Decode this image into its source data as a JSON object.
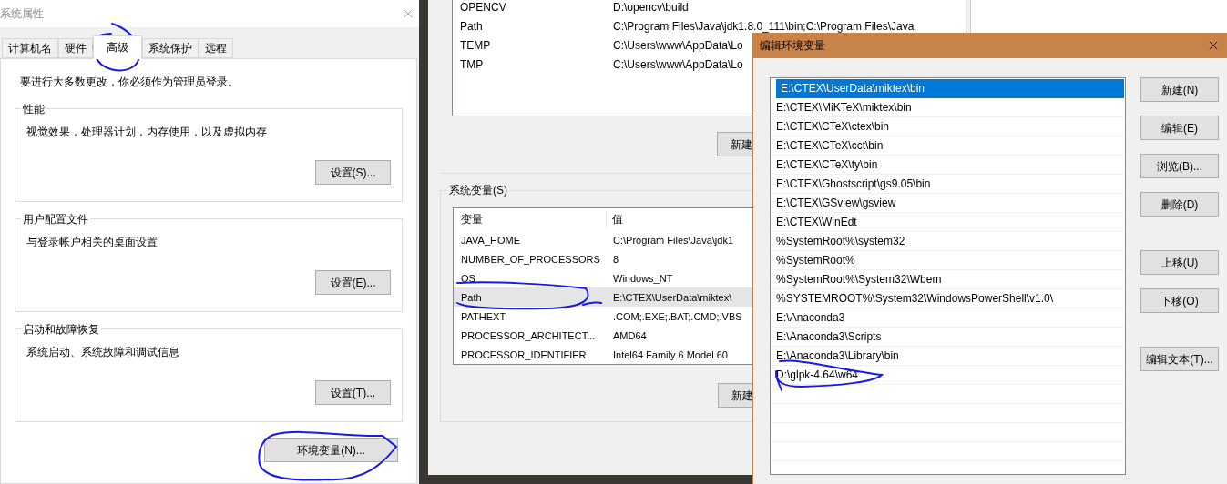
{
  "system_properties": {
    "title": "系统属性",
    "tabs": [
      {
        "label": "计算机名",
        "selected": false
      },
      {
        "label": "硬件",
        "selected": false
      },
      {
        "label": "高级",
        "selected": true
      },
      {
        "label": "系统保护",
        "selected": false
      },
      {
        "label": "远程",
        "selected": false
      }
    ],
    "admin_note": "要进行大多数更改，你必须作为管理员登录。",
    "groups": [
      {
        "title": "性能",
        "description": "视觉效果，处理器计划，内存使用，以及虚拟内存",
        "button": "设置(S)..."
      },
      {
        "title": "用户配置文件",
        "description": "与登录帐户相关的桌面设置",
        "button": "设置(E)..."
      },
      {
        "title": "启动和故障恢复",
        "description": "系统启动、系统故障和调试信息",
        "button": "设置(T)..."
      }
    ],
    "env_button": "环境变量(N)..."
  },
  "environment_variables": {
    "user_vars": [
      {
        "name": "OPENCV",
        "value": "D:\\opencv\\build"
      },
      {
        "name": "Path",
        "value": "C:\\Program Files\\Java\\jdk1.8.0_111\\bin;C:\\Program Files\\Java"
      },
      {
        "name": "TEMP",
        "value": "C:\\Users\\www\\AppData\\Lo"
      },
      {
        "name": "TMP",
        "value": "C:\\Users\\www\\AppData\\Lo"
      }
    ],
    "user_new_button": "新建",
    "system_group_title": "系统变量(S)",
    "columns": [
      "变量",
      "值"
    ],
    "system_vars": [
      {
        "name": "JAVA_HOME",
        "value": "C:\\Program Files\\Java\\jdk1",
        "selected": false
      },
      {
        "name": "NUMBER_OF_PROCESSORS",
        "value": "8",
        "selected": false
      },
      {
        "name": "OS",
        "value": "Windows_NT",
        "selected": false
      },
      {
        "name": "Path",
        "value": "E:\\CTEX\\UserData\\miktex\\",
        "selected": true
      },
      {
        "name": "PATHEXT",
        "value": ".COM;.EXE;.BAT;.CMD;.VBS",
        "selected": false
      },
      {
        "name": "PROCESSOR_ARCHITECT...",
        "value": "AMD64",
        "selected": false
      },
      {
        "name": "PROCESSOR_IDENTIFIER",
        "value": "Intel64 Family 6 Model 60",
        "selected": false
      }
    ],
    "system_new_button": "新建"
  },
  "edit_environment_variable": {
    "title": "编辑环境变量",
    "entries": [
      {
        "text": "E:\\CTEX\\UserData\\miktex\\bin",
        "selected": true
      },
      {
        "text": "E:\\CTEX\\MiKTeX\\miktex\\bin",
        "selected": false
      },
      {
        "text": "E:\\CTEX\\CTeX\\ctex\\bin",
        "selected": false
      },
      {
        "text": "E:\\CTEX\\CTeX\\cct\\bin",
        "selected": false
      },
      {
        "text": "E:\\CTEX\\CTeX\\ty\\bin",
        "selected": false
      },
      {
        "text": "E:\\CTEX\\Ghostscript\\gs9.05\\bin",
        "selected": false
      },
      {
        "text": "E:\\CTEX\\GSview\\gsview",
        "selected": false
      },
      {
        "text": "E:\\CTEX\\WinEdt",
        "selected": false
      },
      {
        "text": "%SystemRoot%\\system32",
        "selected": false
      },
      {
        "text": "%SystemRoot%",
        "selected": false
      },
      {
        "text": "%SystemRoot%\\System32\\Wbem",
        "selected": false
      },
      {
        "text": "%SYSTEMROOT%\\System32\\WindowsPowerShell\\v1.0\\",
        "selected": false
      },
      {
        "text": "E:\\Anaconda3",
        "selected": false
      },
      {
        "text": "E:\\Anaconda3\\Scripts",
        "selected": false
      },
      {
        "text": "E:\\Anaconda3\\Library\\bin",
        "selected": false
      },
      {
        "text": "D:\\glpk-4.64\\w64",
        "selected": false
      }
    ],
    "button_groups": [
      [
        "新建(N)",
        "编辑(E)",
        "浏览(B)...",
        "删除(D)"
      ],
      [
        "上移(U)",
        "下移(O)"
      ],
      [
        "编辑文本(T)..."
      ]
    ]
  }
}
